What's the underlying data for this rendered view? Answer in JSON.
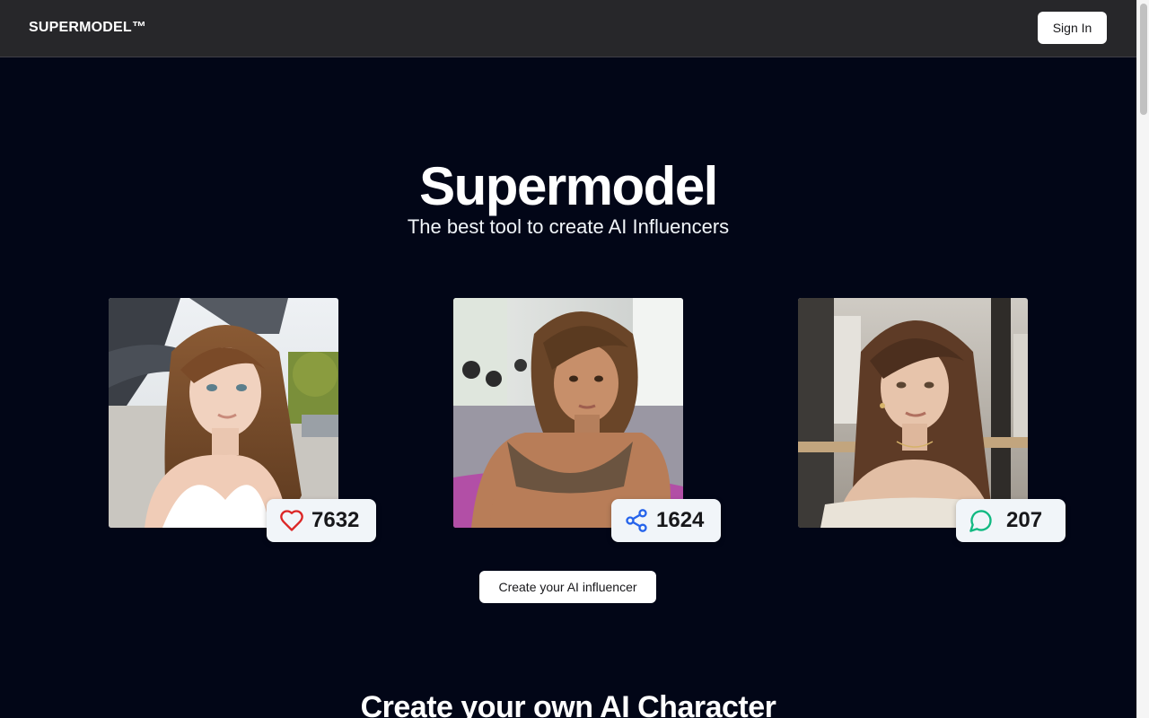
{
  "nav": {
    "brand": "SUPERMODEL™",
    "sign_in_label": "Sign In"
  },
  "hero": {
    "title": "Supermodel",
    "subtitle": "The best tool to create AI Influencers"
  },
  "cards": [
    {
      "image": "woman-at-eiffel-tower-photo",
      "stat_icon": "heart-icon",
      "stat_value": "7632",
      "stat_color": "#dc2626"
    },
    {
      "image": "woman-at-gym-photo",
      "stat_icon": "share-icon",
      "stat_value": "1624",
      "stat_color": "#2563eb"
    },
    {
      "image": "woman-at-cafe-photo",
      "stat_icon": "message-icon",
      "stat_value": "207",
      "stat_color": "#10b981"
    }
  ],
  "cta_label": "Create your AI influencer",
  "section": {
    "title": "Create your own AI Character"
  },
  "colors": {
    "background": "#020617",
    "navbar": "#27272a",
    "stat_badge": "#f1f5f9"
  }
}
